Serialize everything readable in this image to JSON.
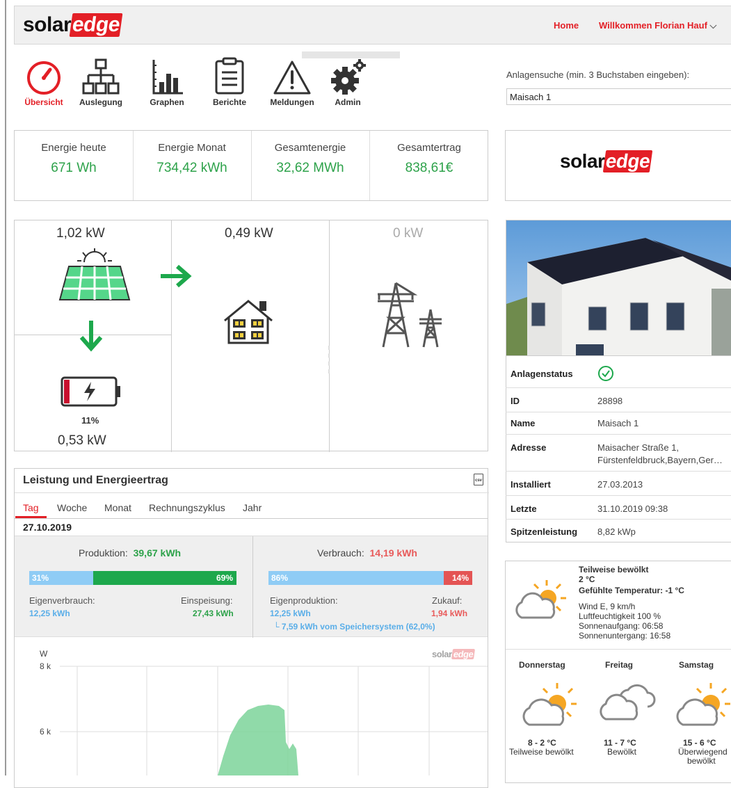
{
  "header": {
    "logo_solar": "solar",
    "logo_edge": "edge",
    "home": "Home",
    "welcome": "Willkommen Florian Hauf"
  },
  "nav": [
    {
      "label": "Übersicht",
      "icon": "gauge-icon",
      "active": true
    },
    {
      "label": "Auslegung",
      "icon": "hierarchy-icon"
    },
    {
      "label": "Graphen",
      "icon": "bar-chart-icon"
    },
    {
      "label": "Berichte",
      "icon": "clipboard-icon"
    },
    {
      "label": "Meldungen",
      "icon": "warning-icon"
    },
    {
      "label": "Admin",
      "icon": "gears-icon"
    }
  ],
  "search": {
    "label": "Anlagensuche (min. 3 Buchstaben eingeben):",
    "value": "Maisach 1"
  },
  "kpis": [
    {
      "title": "Energie heute",
      "value": "671 Wh"
    },
    {
      "title": "Energie Monat",
      "value": "734,42 kWh"
    },
    {
      "title": "Gesamtenergie",
      "value": "32,62 MWh"
    },
    {
      "title": "Gesamtertrag",
      "value": "838,61€"
    }
  ],
  "flow": {
    "pv": "1,02 kW",
    "house": "0,49 kW",
    "grid": "0 kW",
    "battery_percent": "11%",
    "battery_level": 0.11,
    "battery": "0,53 kW"
  },
  "energy": {
    "title": "Leistung und Energieertrag",
    "csv_icon_text": "csv",
    "tabs": [
      "Tag",
      "Woche",
      "Monat",
      "Rechnungszyklus",
      "Jahr"
    ],
    "active_tab": "Tag",
    "date": "27.10.2019",
    "production": {
      "label": "Produktion:",
      "value": "39,67 kWh",
      "self_pct": "31%",
      "feed_pct": "69%",
      "self_fraction": 0.31,
      "self_label": "Eigenverbrauch:",
      "self_value": "12,25 kWh",
      "feed_label": "Einspeisung:",
      "feed_value": "27,43 kWh"
    },
    "consumption": {
      "label": "Verbrauch:",
      "value": "14,19 kWh",
      "own_pct": "86%",
      "buy_pct": "14%",
      "own_fraction": 0.86,
      "own_label": "Eigenproduktion:",
      "own_value": "12,25 kWh",
      "buy_label": "Zukauf:",
      "buy_value": "1,94 kWh",
      "storage_note": "└ 7,59 kWh vom Speichersystem (62,0%)"
    }
  },
  "chart_data": {
    "type": "area",
    "ylabel": "W",
    "yticks": [
      "8 k",
      "6 k"
    ],
    "ylim": [
      0,
      8000
    ],
    "grid": true,
    "watermark_solar": "solar",
    "watermark_edge": "edge"
  },
  "site": {
    "logo_solar": "solar",
    "logo_edge": "edge",
    "rows": [
      {
        "label": "Anlagenstatus",
        "value": ""
      },
      {
        "label": "ID",
        "value": "28898"
      },
      {
        "label": "Name",
        "value": "Maisach 1"
      },
      {
        "label": "Adresse",
        "value": "Maisacher Straße 1,",
        "value2": "Fürstenfeldbruck,Bayern,Ger…"
      },
      {
        "label": "Installiert",
        "value": "27.03.2013"
      },
      {
        "label": "Letzte",
        "value": "31.10.2019 09:38"
      },
      {
        "label": "Spitzenleistung",
        "value": "8,82 kWp"
      }
    ]
  },
  "weather": {
    "current": {
      "condition": "Teilweise bewölkt",
      "temp": "2 °C",
      "feels": "Gefühlte Temperatur: -1 °C",
      "wind": "Wind E, 9 km/h",
      "humidity": "Luftfeuchtigkeit 100 %",
      "sunrise": "Sonnenaufgang: 06:58",
      "sunset": "Sonnenuntergang: 16:58"
    },
    "forecast": [
      {
        "day": "Donnerstag",
        "temp": "8 - 2 °C",
        "desc": "Teilweise bewölkt",
        "icon": "partly-cloudy-icon"
      },
      {
        "day": "Freitag",
        "temp": "11 - 7 °C",
        "desc": "Bewölkt",
        "icon": "cloudy-icon"
      },
      {
        "day": "Samstag",
        "temp": "15 - 6 °C",
        "desc": "Überwiegend",
        "desc2": "bewölkt",
        "icon": "partly-cloudy-icon"
      }
    ]
  }
}
